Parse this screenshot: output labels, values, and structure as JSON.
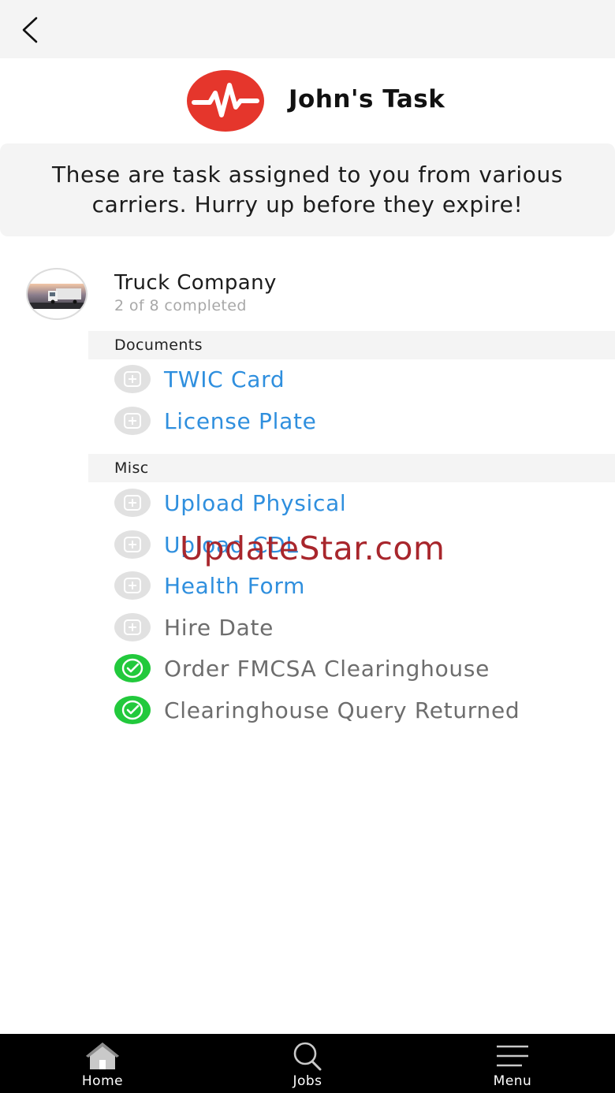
{
  "header": {
    "title": "John's Task"
  },
  "notice": {
    "text": "These are task assigned to you from various carriers. Hurry up before they expire!"
  },
  "company": {
    "name": "Truck Company",
    "progress": "2 of 8 completed"
  },
  "sections": {
    "documents": {
      "title": "Documents"
    },
    "misc": {
      "title": "Misc"
    }
  },
  "tasks": {
    "twic": {
      "label": "TWIC Card",
      "status": "pending"
    },
    "plate": {
      "label": "License Plate",
      "status": "pending"
    },
    "physical": {
      "label": "Upload Physical",
      "status": "pending"
    },
    "cdl": {
      "label": "Upload CDL",
      "status": "pending"
    },
    "health": {
      "label": "Health Form",
      "status": "pending"
    },
    "hire": {
      "label": "Hire Date",
      "status": "pending"
    },
    "fmcsa": {
      "label": "Order FMCSA Clearinghouse",
      "status": "completed"
    },
    "query": {
      "label": "Clearinghouse Query Returned",
      "status": "completed"
    }
  },
  "watermark": {
    "text": "UpdateStar.com"
  },
  "tabbar": {
    "home": {
      "label": "Home",
      "icon": "home-icon"
    },
    "jobs": {
      "label": "Jobs",
      "icon": "search-icon"
    },
    "menu": {
      "label": "Menu",
      "icon": "menu-icon"
    }
  },
  "colors": {
    "accent_blue": "#2f8fde",
    "logo_red": "#e5362c",
    "done_green": "#22c93c",
    "tabbar_bg": "#000000"
  }
}
